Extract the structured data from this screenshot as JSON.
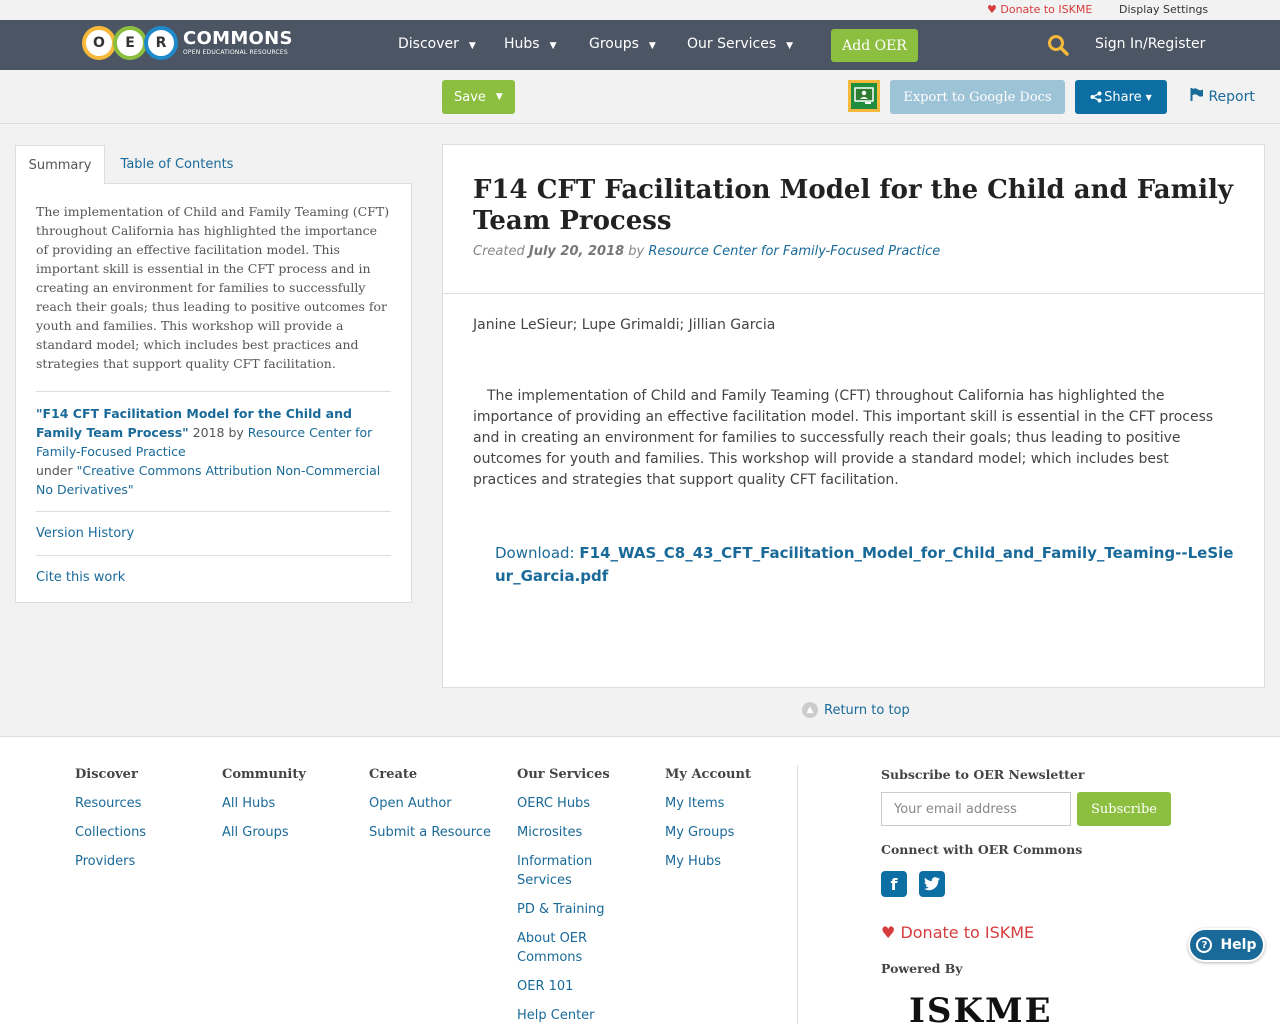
{
  "utility": {
    "donate": "Donate to ISKME",
    "display_settings": "Display Settings"
  },
  "nav": {
    "logo_letters": [
      "O",
      "E",
      "R"
    ],
    "logo_word": "COMMONS",
    "logo_tagline": "OPEN EDUCATIONAL RESOURCES",
    "items": [
      "Discover",
      "Hubs",
      "Groups",
      "Our Services"
    ],
    "add_oer": "Add OER",
    "signin": "Sign In/Register"
  },
  "actions": {
    "save": "Save",
    "export": "Export to Google Docs",
    "share": "Share",
    "report": "Report"
  },
  "sidebar": {
    "tabs": [
      "Summary",
      "Table of Contents"
    ],
    "summary": "The implementation of Child and Family Teaming (CFT) throughout California has highlighted the importance of providing an effective facilitation model. This important skill is essential in the CFT process and in creating an environment for families to successfully reach their goals; thus leading to positive outcomes for youth and families. This workshop will provide a standard model; which includes best practices and strategies that support quality CFT facilitation.",
    "cite_title": "\"F14 CFT Facilitation Model for the Child and Family Team Process\"",
    "cite_year": " 2018 by ",
    "cite_author": "Resource Center for Family-Focused Practice",
    "cite_under": "under ",
    "cite_license": "\"Creative Commons Attribution Non-Commercial No Derivatives\"",
    "version_history": "Version History",
    "cite_work": "Cite this work"
  },
  "resource": {
    "title": "F14 CFT Facilitation Model for the Child and Family Team Process",
    "created_label": "Created ",
    "created_date": "July 20, 2018",
    "by": " by ",
    "author": "Resource Center for Family-Focused Practice",
    "authors": "Janine LeSieur; Lupe Grimaldi; Jillian Garcia",
    "abstract": "The implementation of Child and Family Teaming (CFT) throughout California has highlighted the importance of providing an effective facilitation model. This important skill is essential in the CFT process and in creating an environment for families to successfully reach their goals; thus leading to positive outcomes for youth and families. This workshop will provide a standard model; which includes best practices and strategies that support quality CFT facilitation.",
    "download_label": "Download: ",
    "download_file": "F14_WAS_C8_43_CFT_Facilitation_Model_for_Child_and_Family_Teaming--LeSieur_Garcia.pdf"
  },
  "return_top": "Return to top",
  "footer": {
    "discover": {
      "title": "Discover",
      "links": [
        "Resources",
        "Collections",
        "Providers"
      ]
    },
    "community": {
      "title": "Community",
      "links": [
        "All Hubs",
        "All Groups"
      ]
    },
    "create": {
      "title": "Create",
      "links": [
        "Open Author",
        "Submit a Resource"
      ]
    },
    "services": {
      "title": "Our Services",
      "links": [
        "OERC Hubs",
        "Microsites",
        "Information Services",
        "PD & Training",
        "About OER Commons",
        "OER 101",
        "Help Center"
      ]
    },
    "account": {
      "title": "My Account",
      "links": [
        "My Items",
        "My Groups",
        "My Hubs"
      ]
    },
    "newsletter_title": "Subscribe to OER Newsletter",
    "email_placeholder": "Your email address",
    "subscribe": "Subscribe",
    "connect_title": "Connect with OER Commons",
    "donate": "Donate to ISKME",
    "powered_by": "Powered By",
    "iskme": "ISKME"
  },
  "help": "Help",
  "colors": {
    "nav_bg": "#4b5563",
    "accent_green": "#8cbf3f",
    "link_blue": "#1a6a99",
    "share_blue": "#0d6ea4",
    "donate_red": "#d63c3c"
  }
}
